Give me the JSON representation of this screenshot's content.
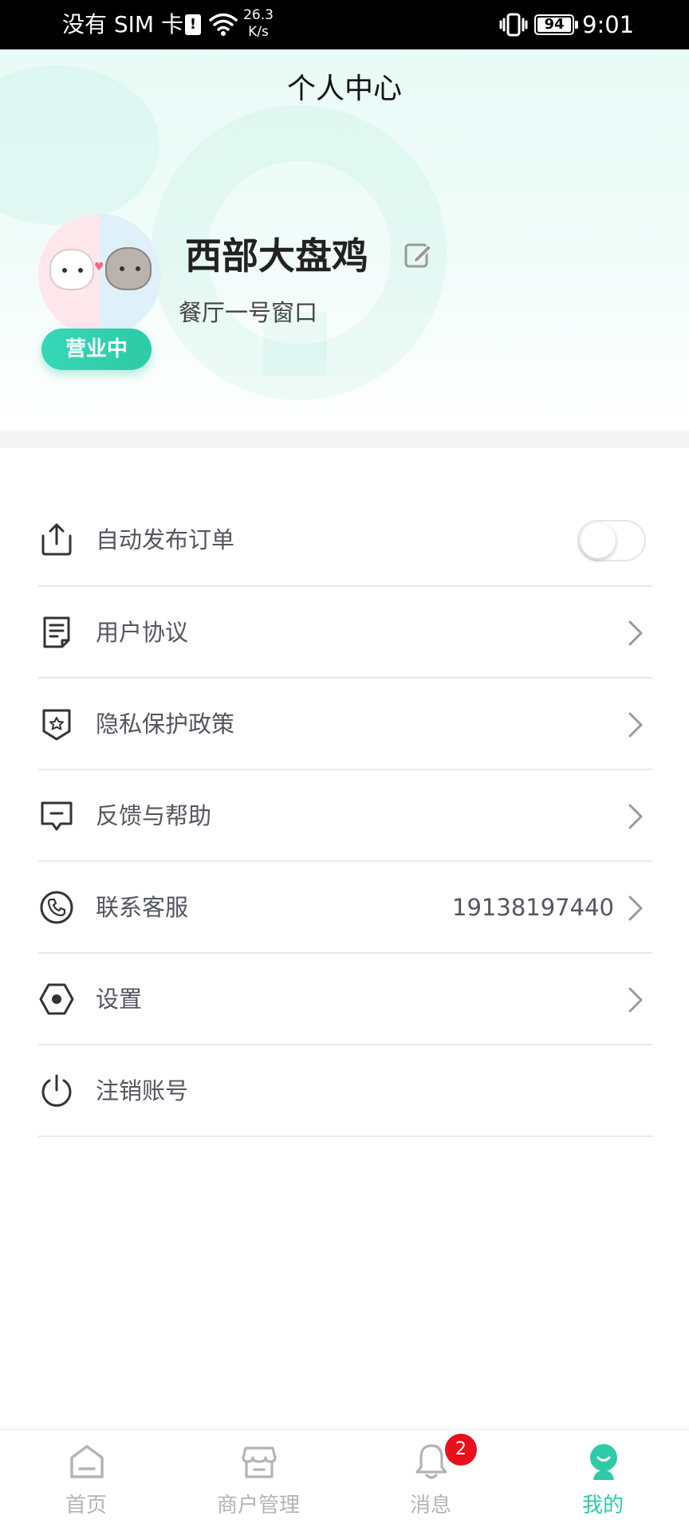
{
  "status_bar": {
    "carrier": "没有 SIM 卡",
    "speed_value": "26.3",
    "speed_unit": "K/s",
    "battery": "94",
    "time": "9:01"
  },
  "header": {
    "title": "个人中心",
    "store_name": "西部大盘鸡",
    "store_sub": "餐厅一号窗口",
    "status_badge": "营业中"
  },
  "menu": {
    "items": [
      {
        "label": "自动发布订单",
        "icon": "upload-share-icon",
        "control": "toggle",
        "toggle_on": false
      },
      {
        "label": "用户协议",
        "icon": "document-icon",
        "control": "chevron"
      },
      {
        "label": "隐私保护政策",
        "icon": "shield-star-icon",
        "control": "chevron"
      },
      {
        "label": "反馈与帮助",
        "icon": "message-icon",
        "control": "chevron"
      },
      {
        "label": "联系客服",
        "icon": "phone-icon",
        "control": "chevron",
        "value": "19138197440"
      },
      {
        "label": "设置",
        "icon": "hexagon-settings-icon",
        "control": "chevron"
      },
      {
        "label": "注销账号",
        "icon": "power-icon",
        "control": "none"
      }
    ]
  },
  "tabbar": {
    "tabs": [
      {
        "label": "首页",
        "icon": "home-icon",
        "active": false
      },
      {
        "label": "商户管理",
        "icon": "store-icon",
        "active": false
      },
      {
        "label": "消息",
        "icon": "bell-icon",
        "active": false,
        "badge": "2"
      },
      {
        "label": "我的",
        "icon": "profile-icon",
        "active": true
      }
    ]
  },
  "colors": {
    "accent": "#2fcaa7",
    "badge_red": "#e8101a",
    "text_primary": "#222222",
    "text_menu": "#555560",
    "tab_inactive": "#b4b4b4"
  }
}
